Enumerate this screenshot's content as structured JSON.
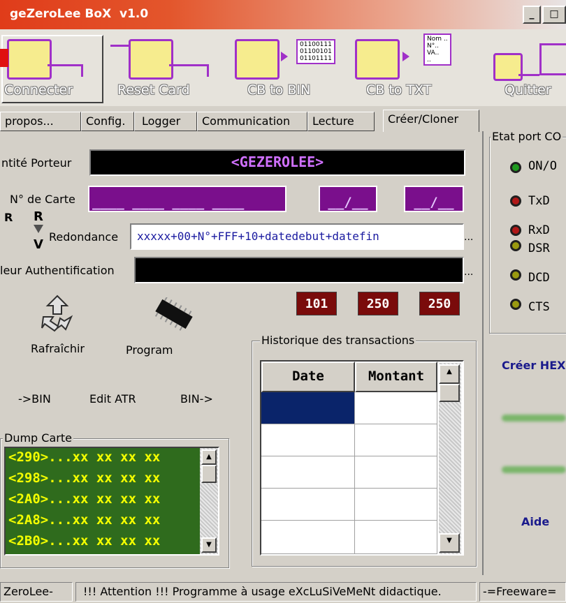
{
  "window": {
    "title": "geZeroLee BoX  v1.0",
    "min_label": "_",
    "max_label": "□"
  },
  "toolbar": {
    "connect": "Connecter",
    "reset": "Reset Card",
    "cb_bin": "CB to BIN",
    "cb_txt": "CB to TXT",
    "quit": "Quitter",
    "bin_icon_text": "01100111\n01100101\n01101111",
    "txt_icon_text": "Nom ..\nN°..\nVA..\n.."
  },
  "tabs": [
    "propos...",
    "Config.",
    "Logger",
    "Communication",
    "Lecture",
    "Créer/Cloner"
  ],
  "form": {
    "identity_label": "ntité Porteur",
    "identity_value": "<GEZEROLEE>",
    "card_label": "N° de Carte",
    "card_value": "____ ____ ____ ____",
    "date1": "__/__",
    "date2": "__/__",
    "redundancy_label": "Redondance",
    "redundancy_value": "xxxxx+00+N°+FFF+10+datedebut+datefin",
    "auth_label": "leur Authentification",
    "auth_value": "",
    "ellipsis": "...",
    "rv_top": "R",
    "rv_bottom": "V"
  },
  "counters": [
    "101",
    "250",
    "250"
  ],
  "actions": {
    "refresh": "Rafraîchir",
    "program": "Program",
    "to_bin": "->BIN",
    "edit_atr": "Edit ATR",
    "bin_from": "BIN->"
  },
  "history": {
    "title": "Historique des transactions",
    "columns": [
      "Date",
      "Montant"
    ]
  },
  "dump": {
    "title": "Dump Carte",
    "lines": [
      "<290>...xx xx xx xx",
      "<298>...xx xx xx xx",
      "<2A0>...xx xx xx xx",
      "<2A8>...xx xx xx xx",
      "<2B0>...xx xx xx xx"
    ]
  },
  "port": {
    "title": "Etat port CO",
    "leds": [
      {
        "label": "ON/O",
        "color": "#1f9a1f"
      },
      {
        "label": "TxD",
        "color": "#b01818"
      },
      {
        "label": "RxD",
        "color": "#b01818"
      },
      {
        "label": "DSR",
        "color": "#9a9a10"
      },
      {
        "label": "DCD",
        "color": "#9a9a10"
      },
      {
        "label": "CTS",
        "color": "#9a9a10"
      }
    ]
  },
  "side": {
    "create_hex": "Créer HEX",
    "help": "Aide"
  },
  "status": {
    "left": "ZeroLee-",
    "middle": "!!! Attention !!! Programme à usage eXcLuSiVeMeNt didactique.",
    "right": "-=Freeware="
  }
}
